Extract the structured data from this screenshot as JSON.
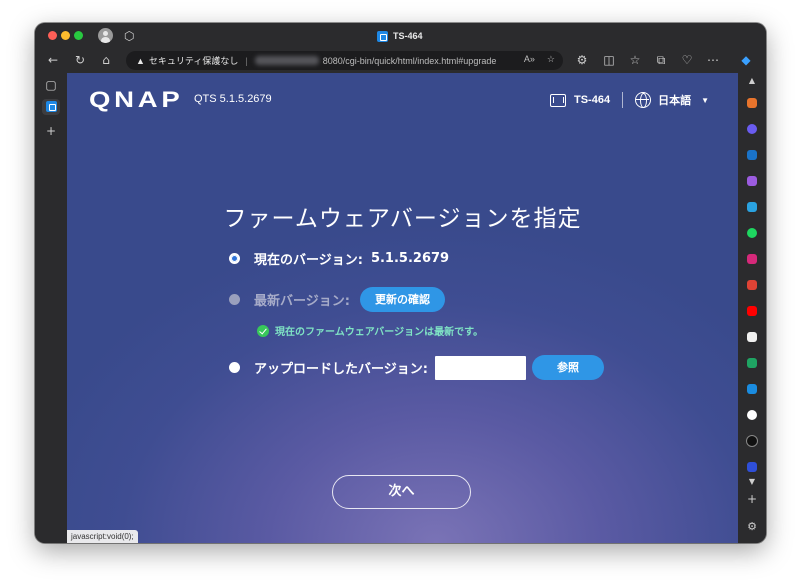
{
  "browser": {
    "tab_title": "TS-464",
    "address": {
      "security_label": "セキュリティ保護なし",
      "url_visible": "8080/cgi-bin/quick/html/index.html#upgrade"
    },
    "status_bar": "javascript:void(0);"
  },
  "header": {
    "logo": "QNAP",
    "version": "QTS 5.1.5.2679",
    "device": "TS-464",
    "language": "日本語"
  },
  "page": {
    "title": "ファームウェアバージョンを指定",
    "options": {
      "current_label": "現在のバージョン:",
      "current_value": "5.1.5.2679",
      "latest_label": "最新バージョン:",
      "check_button": "更新の確認",
      "latest_status": "現在のファームウェアバージョンは最新です。",
      "upload_label": "アップロードしたバージョン:",
      "browse_button": "参照"
    },
    "next_button": "次へ"
  },
  "colors": {
    "accent": "#2f96e6",
    "success": "#38c75a",
    "background": "#3f4d92"
  }
}
